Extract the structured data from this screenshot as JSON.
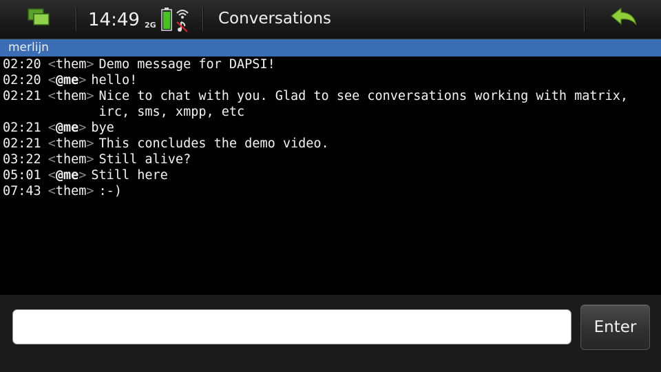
{
  "statusbar": {
    "task_switcher_icon": "task-switcher-icon",
    "clock": "14:49",
    "network": "2G",
    "battery_icon": "battery-icon",
    "wifi_icon": "wifi-muted-icon",
    "title": "Conversations",
    "back_icon": "back-arrow-icon",
    "back_color": "#8fcf3a"
  },
  "contact": {
    "name": "merlijn",
    "bar_color": "#3a6db3"
  },
  "messages": [
    {
      "time": "02:20",
      "nick": "them",
      "text": "Demo message for DAPSI!"
    },
    {
      "time": "02:20",
      "nick": "@me",
      "text": "hello!"
    },
    {
      "time": "02:21",
      "nick": "them",
      "text": "Nice to chat with you. Glad to see conversations working with matrix, irc, sms, xmpp, etc"
    },
    {
      "time": "02:21",
      "nick": "@me",
      "text": "bye"
    },
    {
      "time": "02:21",
      "nick": "them",
      "text": "This concludes the demo video."
    },
    {
      "time": "03:22",
      "nick": "them",
      "text": "Still alive?"
    },
    {
      "time": "05:01",
      "nick": "@me",
      "text": "Still here"
    },
    {
      "time": "07:43",
      "nick": "them",
      "text": ":-)"
    }
  ],
  "composer": {
    "input_value": "",
    "enter_label": "Enter"
  }
}
